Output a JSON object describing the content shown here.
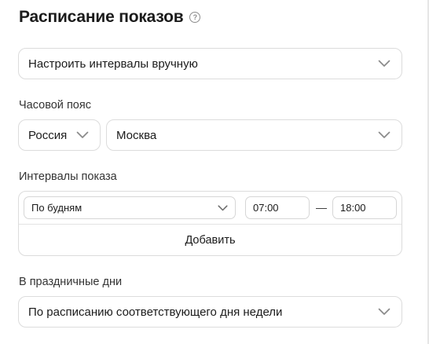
{
  "header": {
    "title": "Расписание показов",
    "help_icon": "question-circle-icon",
    "help_glyph": "?"
  },
  "mode_select": {
    "value": "Настроить интервалы вручную",
    "icon": "chevron-down-icon"
  },
  "timezone": {
    "label": "Часовой пояс",
    "country": "Россия",
    "city": "Москва"
  },
  "intervals": {
    "label": "Интервалы показа",
    "rows": [
      {
        "days": "По будням",
        "from": "07:00",
        "separator": "—",
        "to": "18:00"
      }
    ],
    "add_label": "Добавить"
  },
  "holidays": {
    "label": "В праздничные дни",
    "value": "По расписанию соответствующего дня недели"
  },
  "colors": {
    "border": "#dcdcdc",
    "text": "#1b1b1b",
    "muted": "#8c8c8c"
  }
}
